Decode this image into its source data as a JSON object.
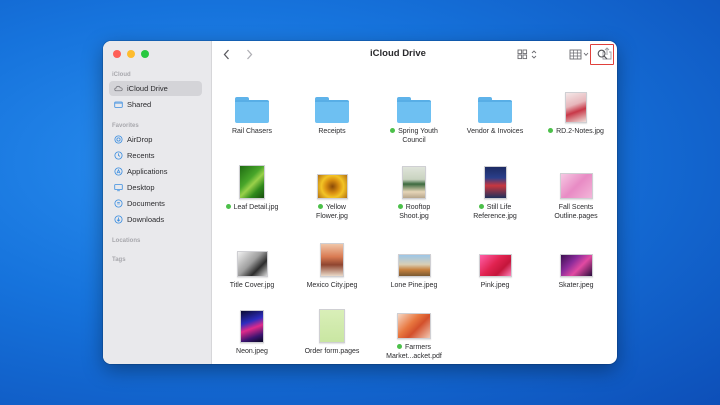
{
  "window": {
    "title": "iCloud Drive"
  },
  "sidebar": {
    "sections": [
      {
        "label": "iCloud"
      },
      {
        "label": "Favorites"
      },
      {
        "label": "Locations"
      },
      {
        "label": "Tags"
      }
    ],
    "items": [
      {
        "label": "iCloud Drive",
        "icon": "cloud-icon",
        "selected": true
      },
      {
        "label": "Shared",
        "icon": "shared-folder-icon"
      },
      {
        "label": "AirDrop",
        "icon": "airdrop-icon"
      },
      {
        "label": "Recents",
        "icon": "clock-icon"
      },
      {
        "label": "Applications",
        "icon": "applications-icon"
      },
      {
        "label": "Desktop",
        "icon": "desktop-icon"
      },
      {
        "label": "Documents",
        "icon": "document-icon"
      },
      {
        "label": "Downloads",
        "icon": "download-icon"
      }
    ]
  },
  "toolbar": {
    "back": "back-chevron-icon",
    "forward": "forward-chevron-icon",
    "view": "grid-view-icon",
    "group": "group-icon",
    "share": "share-icon",
    "tag": "tag-icon",
    "more": "more-options-icon",
    "search": "search-icon"
  },
  "colors": {
    "tag_green": "#4cc04a",
    "search_highlight": "#e0403b",
    "folder_blue": "#6ec0f2"
  },
  "files": [
    {
      "name": "Rail Chasers",
      "kind": "folder",
      "tag": false
    },
    {
      "name": "Receipts",
      "kind": "folder",
      "tag": false
    },
    {
      "name": "Spring Youth\nCouncil",
      "kind": "folder",
      "tag": true
    },
    {
      "name": "Vendor & Invoices",
      "kind": "folder",
      "tag": false
    },
    {
      "name": "RD.2-Notes.jpg",
      "kind": "image",
      "tag": true
    },
    {
      "name": "Leaf Detail.jpg",
      "kind": "image",
      "tag": true
    },
    {
      "name": "Yellow\nFlower.jpg",
      "kind": "image",
      "tag": true
    },
    {
      "name": "Rooftop\nShoot.jpg",
      "kind": "image",
      "tag": true
    },
    {
      "name": "Still Life\nReference.jpg",
      "kind": "image",
      "tag": true
    },
    {
      "name": "Fall Scents\nOutline.pages",
      "kind": "pages",
      "tag": false
    },
    {
      "name": "Title Cover.jpg",
      "kind": "image",
      "tag": false
    },
    {
      "name": "Mexico City.jpeg",
      "kind": "image",
      "tag": false
    },
    {
      "name": "Lone Pine.jpeg",
      "kind": "image",
      "tag": false
    },
    {
      "name": "Pink.jpeg",
      "kind": "image",
      "tag": false
    },
    {
      "name": "Skater.jpeg",
      "kind": "image",
      "tag": false
    },
    {
      "name": "Neon.jpeg",
      "kind": "image",
      "tag": false
    },
    {
      "name": "Order form.pages",
      "kind": "pages",
      "tag": false
    },
    {
      "name": "Farmers\nMarket...acket.pdf",
      "kind": "pdf",
      "tag": true
    }
  ]
}
